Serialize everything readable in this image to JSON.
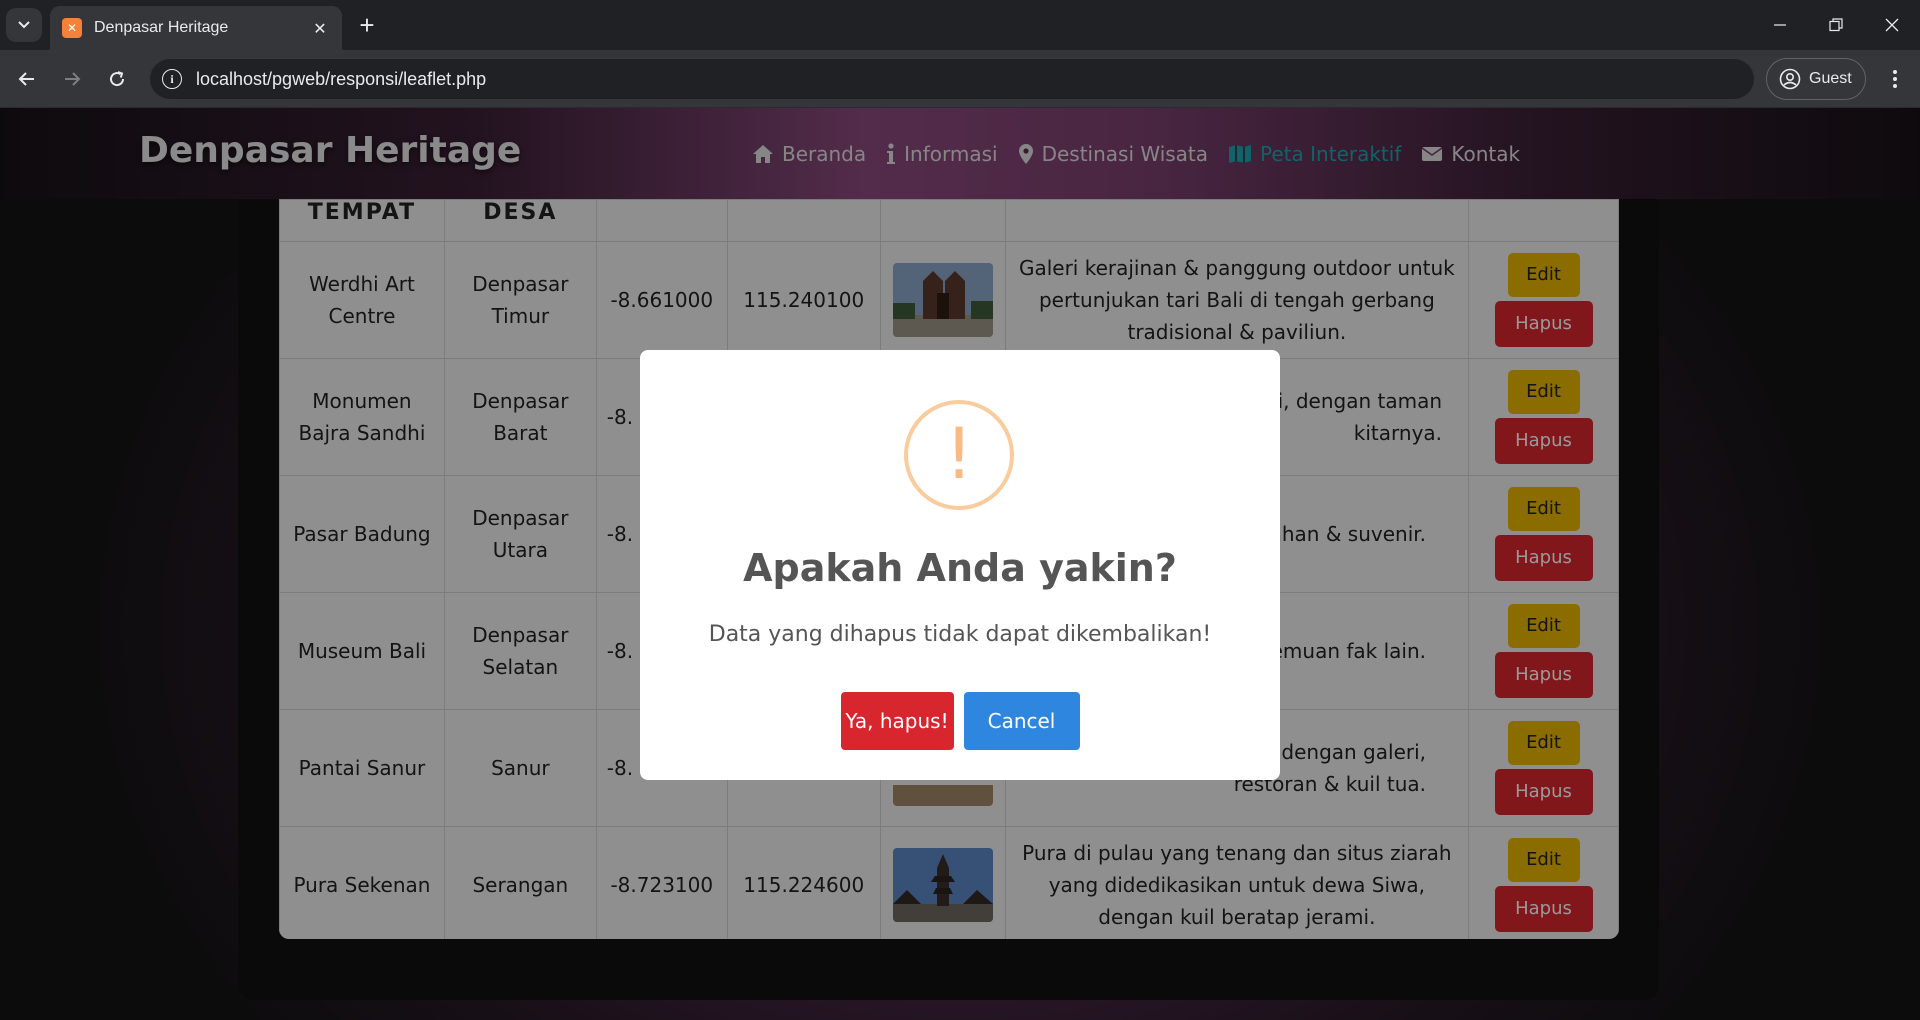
{
  "browser": {
    "tab_title": "Denpasar Heritage",
    "new_tab_symbol": "+",
    "url": "localhost/pgweb/responsi/leaflet.php",
    "profile_label": "Guest"
  },
  "navbar": {
    "brand": "Denpasar Heritage",
    "links": [
      {
        "label": "Beranda",
        "icon": "home-icon"
      },
      {
        "label": "Informasi",
        "icon": "info-icon"
      },
      {
        "label": "Destinasi Wisata",
        "icon": "map-pin-icon"
      },
      {
        "label": "Peta Interaktif",
        "icon": "map-icon",
        "active": true
      },
      {
        "label": "Kontak",
        "icon": "envelope-icon"
      }
    ]
  },
  "table": {
    "headers": [
      "TEMPAT",
      "DESA",
      "",
      "",
      "",
      "",
      ""
    ],
    "edit_label": "Edit",
    "delete_label": "Hapus",
    "rows": [
      {
        "tempat": "Werdhi Art Centre",
        "desa": "Denpasar Timur",
        "lat": "-8.661000",
        "lng": "115.240100",
        "desc": "Galeri kerajinan & panggung outdoor untuk pertunjukan tari Bali di tengah gerbang tradisional & paviliun."
      },
      {
        "tempat": "Monumen Bajra Sandhi",
        "desa": "Denpasar Barat",
        "lat": "-8.",
        "lng": "",
        "desc": "g penuh dengan i, dengan taman kitarnya."
      },
      {
        "tempat": "Pasar Badung",
        "desa": "Denpasar Utara",
        "lat": "-8.",
        "lng": "",
        "desc": "a atap dengan masuk bahan & suvenir."
      },
      {
        "tempat": "Museum Bali",
        "desa": "Denpasar Selatan",
        "lat": "-8.",
        "lng": "",
        "desc": "rah Bali yang tekstil, temuan fak lain."
      },
      {
        "tempat": "Pantai Sanur",
        "desa": "Sanur",
        "lat": "-8.",
        "lng": "",
        "desc": "warna menghiasi dengan galeri, restoran & kuil tua."
      },
      {
        "tempat": "Pura Sekenan",
        "desa": "Serangan",
        "lat": "-8.723100",
        "lng": "115.224600",
        "desc": "Pura di pulau yang tenang dan situs ziarah yang didedikasikan untuk dewa Siwa, dengan kuil beratap jerami."
      }
    ]
  },
  "modal": {
    "icon_symbol": "!",
    "title": "Apakah Anda yakin?",
    "text": "Data yang dihapus tidak dapat dikembalikan!",
    "confirm_label": "Ya, hapus!",
    "cancel_label": "Cancel"
  },
  "colors": {
    "confirm": "#d8262e",
    "cancel": "#2f86de",
    "warning_icon": "#f8bb86",
    "edit": "#e6b400",
    "active_nav": "#1fa3b0"
  }
}
